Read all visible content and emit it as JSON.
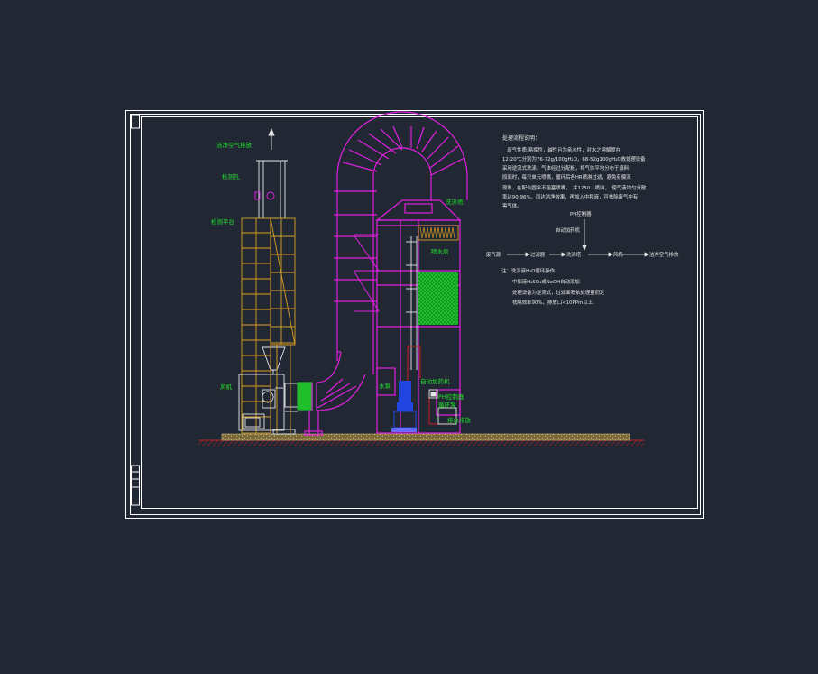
{
  "labels": {
    "clean_air_top": "洁净空气排放",
    "sampling_hole": "检测孔",
    "sampling_platform": "检测平台",
    "fan": "风机",
    "scrubber": "洗涤塔",
    "spray_layer": "喷水层",
    "auto_dosing": "自动加药机",
    "ph_controller_left": "PH控制器",
    "circulation_pump": "循环泵",
    "drain": "排水排放",
    "pump": "水泵"
  },
  "notes": {
    "title": "处理流程说明：",
    "lines": [
      "　废气性质:易挥性，碱性且为亲水性，对水之溶解度在",
      "12-20℃分别为76-72g/100gH₂O，68-52g100gH₂O故处理设备",
      "采用逆流式洗涤，气体经过分配板，将气体平均分布于填料",
      "段面时，每只单元喷嘴，循环后各HR喷淋过滤，避免有偏流",
      "现象，在配合圆伞不阻塞喷嘴，　并1250　喷淋，　使气液均匀分散",
      "率达90-96%，而达洁净效果，再加入中和液，可祛除废气中有",
      "害气体。"
    ]
  },
  "flow": {
    "ph_controller": "PH控制器",
    "auto_dosing": "自动加药机",
    "waste_gas": "废气源",
    "filter": "过滤器",
    "scrubber": "洗涤塔",
    "fan": "风机",
    "clean_air": "洁净空气排放"
  },
  "notes2": {
    "l1": "注：洗涤液H₂O循环操作",
    "l2": "中和液H₂SO₄或NaOH自动添加",
    "l3": "处理设备为逆流式，过滤面积依处理量而定",
    "l4": "祛除效率90%，排放口<10PPm以上."
  },
  "colors": {
    "background": "#222833",
    "frame": "#ffffff",
    "tower": "#e020e0",
    "label": "#22e02c",
    "platform": "#d9a020",
    "fill_media": "#1fbf2c",
    "ground": "#c81e1e",
    "pump": "#2244e0"
  }
}
